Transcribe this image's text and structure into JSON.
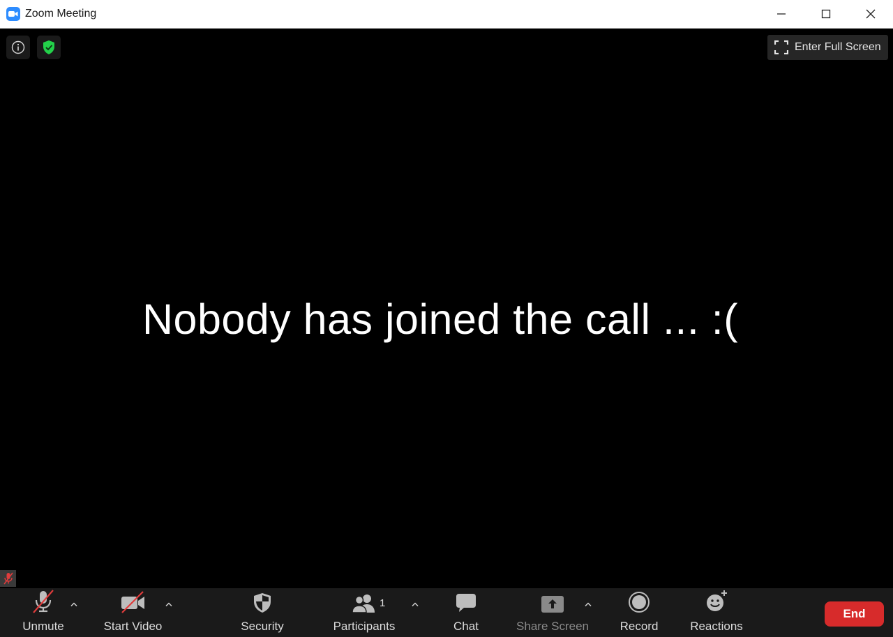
{
  "window": {
    "title": "Zoom Meeting",
    "icons": [
      "zoom-logo-icon",
      "minimize-icon",
      "maximize-icon",
      "close-icon"
    ]
  },
  "stage": {
    "message": "Nobody has joined the call ... :(",
    "fullscreen_label": "Enter Full Screen",
    "icons": [
      "info-icon",
      "encryption-shield-icon",
      "fullscreen-icon",
      "muted-mic-icon"
    ]
  },
  "toolbar": {
    "unmute": "Unmute",
    "start_video": "Start Video",
    "security": "Security",
    "participants": "Participants",
    "participants_count": "1",
    "chat": "Chat",
    "share_screen": "Share Screen",
    "record": "Record",
    "reactions": "Reactions",
    "end": "End"
  },
  "colors": {
    "brand": "#2d8cff",
    "end": "#d72b2b",
    "shield": "#23d14a",
    "toolbar_bg": "#1a1a1a",
    "mute_slash": "#e03c3c"
  }
}
